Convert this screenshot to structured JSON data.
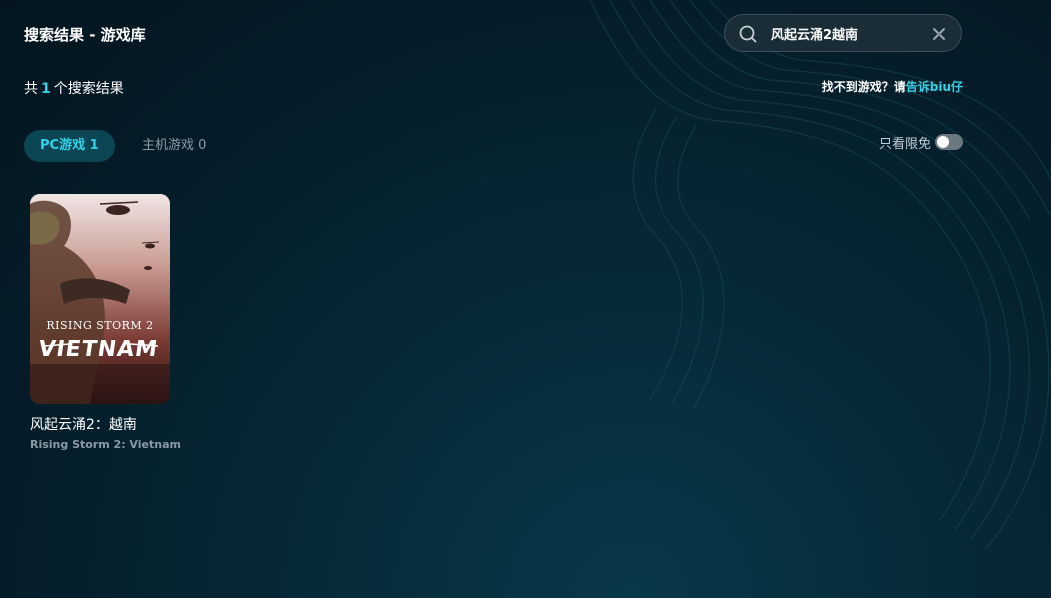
{
  "header": {
    "title": "搜索结果 - 游戏库"
  },
  "search": {
    "value": "风起云涌2越南",
    "placeholder": ""
  },
  "results": {
    "prefix": "共",
    "count": "1",
    "suffix": "个搜索结果"
  },
  "feedback": {
    "text": "找不到游戏？请",
    "link": "告诉biu仔"
  },
  "tabs": [
    {
      "label": "PC游戏 1",
      "active": true
    },
    {
      "label": "主机游戏 0",
      "active": false
    }
  ],
  "filter": {
    "label": "只看限免",
    "enabled": false
  },
  "games": [
    {
      "name": "风起云涌2：越南",
      "subtitle": "Rising Storm 2: Vietnam",
      "cover_title": "RISING STORM 2",
      "cover_subtitle": "VIETNAM"
    }
  ],
  "colors": {
    "accent": "#2dd4e8",
    "background": "#051d29",
    "tab_active_bg": "#0c4553"
  }
}
